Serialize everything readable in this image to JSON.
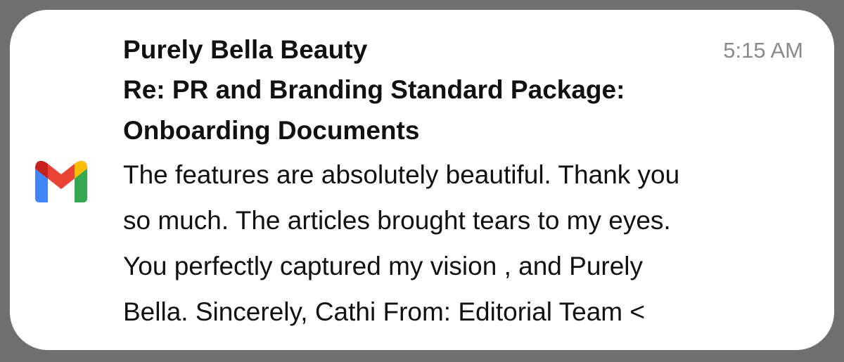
{
  "notification": {
    "app_icon": "gmail-icon",
    "sender": "Purely Bella Beauty",
    "time": "5:15 AM",
    "subject_line_1": "Re: PR and Branding Standard Package:",
    "subject_line_2": "Onboarding Documents",
    "preview_line_1": "The features are absolutely beautiful. Thank you",
    "preview_line_2": "so much. The articles brought tears to my eyes.",
    "preview_line_3": "You perfectly captured my vision , and Purely",
    "preview_line_4": "Bella. Sincerely, Cathi From: Editorial Team <"
  },
  "colors": {
    "background": "#707070",
    "card": "#ffffff",
    "text": "#111111",
    "time": "#8a8a8a",
    "gmail_red": "#EA4335",
    "gmail_blue": "#4285F4",
    "gmail_green": "#34A853",
    "gmail_yellow": "#FBBC04",
    "gmail_dark_red": "#C5221F"
  }
}
